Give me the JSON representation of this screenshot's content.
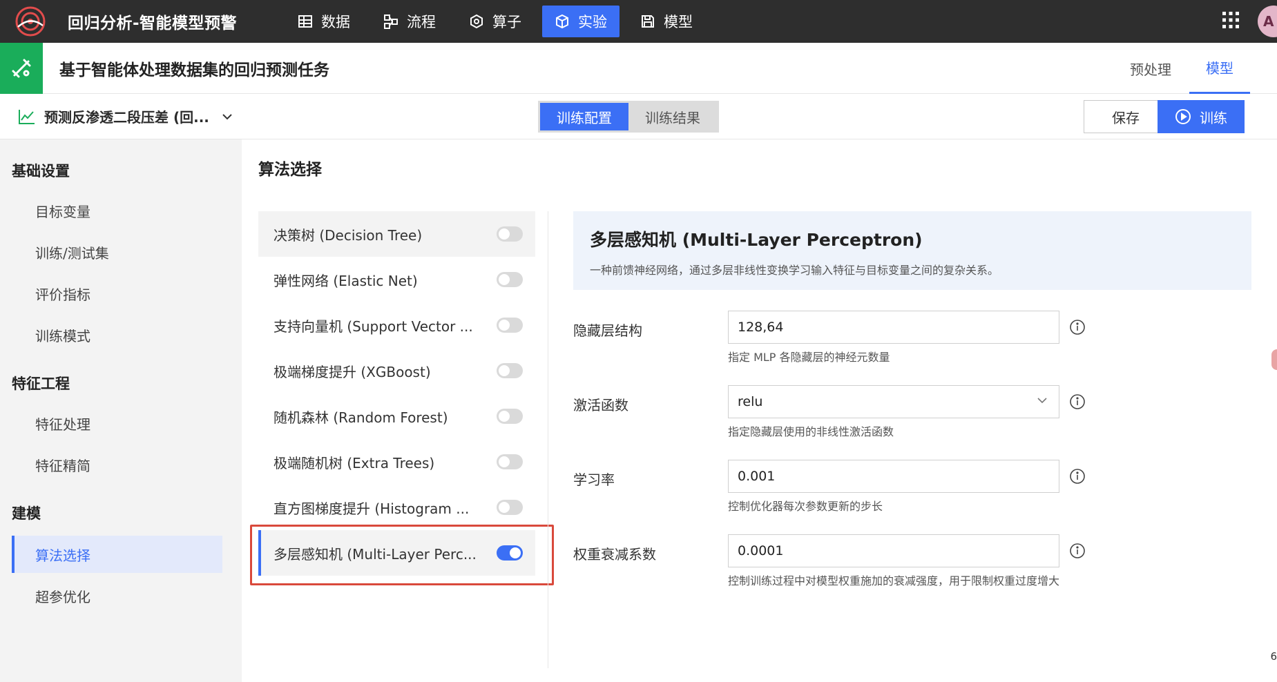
{
  "app": {
    "title": "回归分析-智能模型预警",
    "nav": [
      {
        "label": "数据",
        "icon": "table-icon"
      },
      {
        "label": "流程",
        "icon": "flow-icon"
      },
      {
        "label": "算子",
        "icon": "operator-icon"
      },
      {
        "label": "实验",
        "icon": "cube-icon",
        "active": true
      },
      {
        "label": "模型",
        "icon": "save-icon"
      }
    ],
    "avatar_initial": "A",
    "accent_color": "#3b6ff5"
  },
  "task": {
    "title": "基于智能体处理数据集的回归预测任务",
    "tabs": [
      {
        "label": "预处理"
      },
      {
        "label": "模型",
        "active": true
      }
    ]
  },
  "toolbar": {
    "target": "预测反渗透二段压差 (回...",
    "segments": [
      {
        "label": "训练配置",
        "active": true
      },
      {
        "label": "训练结果"
      }
    ],
    "save_label": "保存",
    "train_label": "训练"
  },
  "sidebar": {
    "groups": [
      {
        "title": "基础设置",
        "items": [
          "目标变量",
          "训练/测试集",
          "评价指标",
          "训练模式"
        ]
      },
      {
        "title": "特征工程",
        "items": [
          "特征处理",
          "特征精简"
        ]
      },
      {
        "title": "建模",
        "items": [
          "算法选择",
          "超参优化"
        ]
      }
    ],
    "active_item": "算法选择"
  },
  "main": {
    "section_title": "算法选择",
    "algorithms": [
      {
        "label": "决策树 (Decision Tree)",
        "enabled": false
      },
      {
        "label": "弹性网络 (Elastic Net)",
        "enabled": false
      },
      {
        "label": "支持向量机 (Support Vector ...",
        "enabled": false
      },
      {
        "label": "极端梯度提升 (XGBoost)",
        "enabled": false
      },
      {
        "label": "随机森林 (Random Forest)",
        "enabled": false
      },
      {
        "label": "极端随机树 (Extra Trees)",
        "enabled": false
      },
      {
        "label": "直方图梯度提升 (Histogram ...",
        "enabled": false
      },
      {
        "label": "多层感知机 (Multi-Layer Perc...",
        "enabled": true
      }
    ],
    "detail": {
      "title": "多层感知机 (Multi-Layer Perceptron)",
      "description": "一种前馈神经网络，通过多层非线性变换学习输入特征与目标变量之间的复杂关系。",
      "params": [
        {
          "label": "隐藏层结构",
          "value": "128,64",
          "help": "指定 MLP 各隐藏层的神经元数量"
        },
        {
          "label": "激活函数",
          "value": "relu",
          "help": "指定隐藏层使用的非线性激活函数",
          "dropdown": true
        },
        {
          "label": "学习率",
          "value": "0.001",
          "help": "控制优化器每次参数更新的步长"
        },
        {
          "label": "权重衰减系数",
          "value": "0.0001",
          "help": "控制训练过程中对模型权重施加的衰减强度，用于限制权重过度增大"
        }
      ]
    }
  },
  "corner_digit": "6"
}
